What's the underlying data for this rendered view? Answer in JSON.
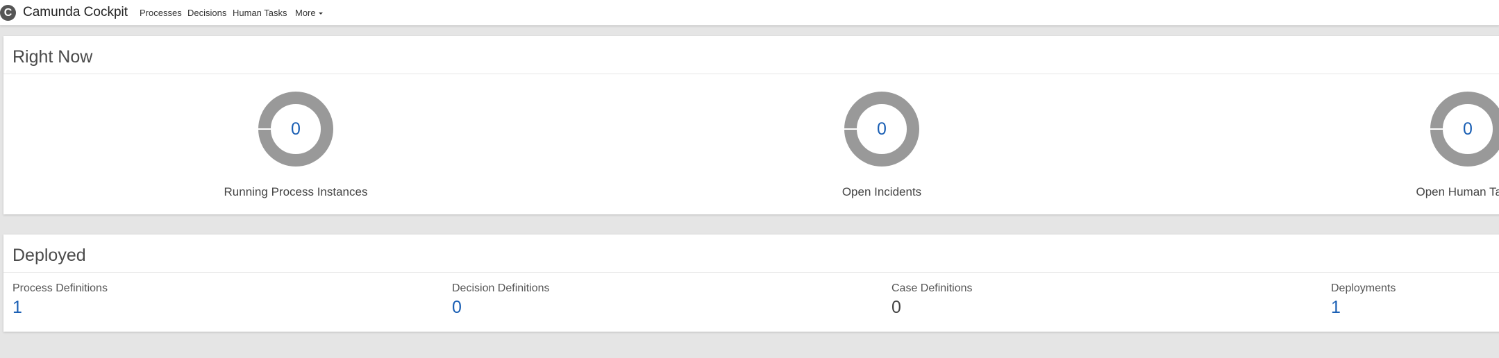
{
  "app": {
    "title": "Camunda Cockpit",
    "logo_letter": "C"
  },
  "nav": {
    "items": [
      {
        "label": "Processes"
      },
      {
        "label": "Decisions"
      },
      {
        "label": "Human Tasks"
      },
      {
        "label": "More"
      }
    ]
  },
  "right_now": {
    "title": "Right Now",
    "stats": [
      {
        "label": "Running Process Instances",
        "value": "0"
      },
      {
        "label": "Open Incidents",
        "value": "0"
      },
      {
        "label": "Open Human Tasks",
        "value": "0"
      }
    ]
  },
  "deployed": {
    "title": "Deployed",
    "items": [
      {
        "label": "Process Definitions",
        "value": "1"
      },
      {
        "label": "Decision Definitions",
        "value": "0"
      },
      {
        "label": "Case Definitions",
        "value": "0"
      },
      {
        "label": "Deployments",
        "value": "1"
      }
    ]
  },
  "colors": {
    "donut": "#999999",
    "link": "#1a5fb4",
    "background": "#e5e5e5"
  }
}
